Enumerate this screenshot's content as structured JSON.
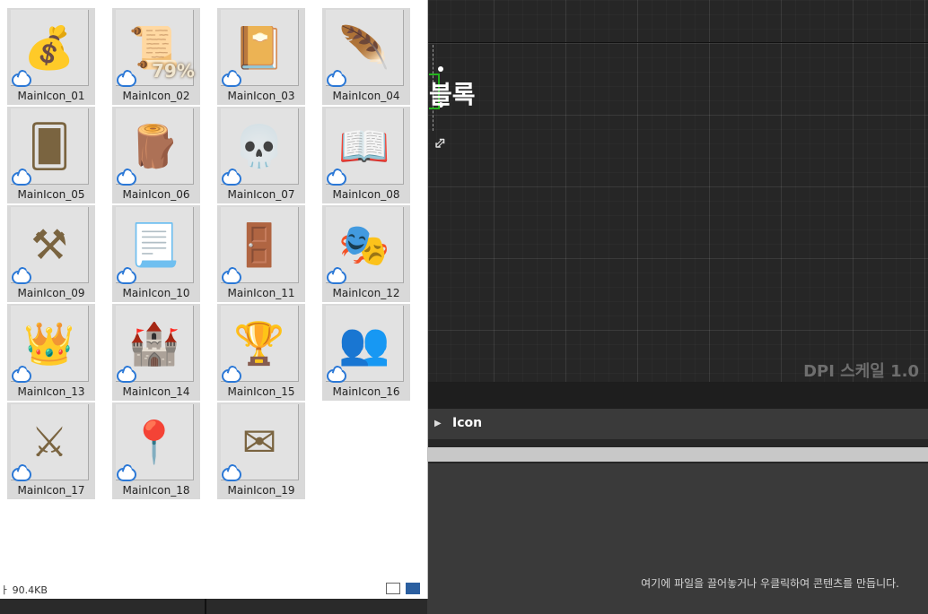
{
  "explorer": {
    "files": [
      {
        "name": "MainIcon_01",
        "icon": "money-bag-icon",
        "glyph": "💰"
      },
      {
        "name": "MainIcon_02",
        "icon": "sale-scroll-icon",
        "glyph": "📜",
        "overlay": "79%"
      },
      {
        "name": "MainIcon_03",
        "icon": "compass-book-icon",
        "glyph": "📔"
      },
      {
        "name": "MainIcon_04",
        "icon": "quill-scroll-icon",
        "glyph": "🪶"
      },
      {
        "name": "MainIcon_05",
        "icon": "cards-icon",
        "glyph": "🂠"
      },
      {
        "name": "MainIcon_06",
        "icon": "tree-stump-icon",
        "glyph": "🪵"
      },
      {
        "name": "MainIcon_07",
        "icon": "bull-skull-icon",
        "glyph": "💀"
      },
      {
        "name": "MainIcon_08",
        "icon": "open-book-icon",
        "glyph": "📖"
      },
      {
        "name": "MainIcon_09",
        "icon": "crossed-hammers-icon",
        "glyph": "⚒"
      },
      {
        "name": "MainIcon_10",
        "icon": "checked-scroll-icon",
        "glyph": "📃"
      },
      {
        "name": "MainIcon_11",
        "icon": "door-icon",
        "glyph": "🚪"
      },
      {
        "name": "MainIcon_12",
        "icon": "mask-icon",
        "glyph": "🎭"
      },
      {
        "name": "MainIcon_13",
        "icon": "crown-shield-icon",
        "glyph": "👑"
      },
      {
        "name": "MainIcon_14",
        "icon": "castle-tower-icon",
        "glyph": "🏰"
      },
      {
        "name": "MainIcon_15",
        "icon": "trophy-icon",
        "glyph": "🏆"
      },
      {
        "name": "MainIcon_16",
        "icon": "group-icon",
        "glyph": "👥"
      },
      {
        "name": "MainIcon_17",
        "icon": "crossed-swords-icon",
        "glyph": "⚔"
      },
      {
        "name": "MainIcon_18",
        "icon": "map-pin-icon",
        "glyph": "📍"
      },
      {
        "name": "MainIcon_19",
        "icon": "sealed-letter-icon",
        "glyph": "✉"
      }
    ],
    "status_text": "ㅏ 90.4KB"
  },
  "canvas": {
    "text_fragment": "블록",
    "dpi_label": "DPI 스케일 1.0"
  },
  "details": {
    "section_label": "Icon"
  },
  "content_browser": {
    "empty_message": "여기에 파일을 끌어놓거나 우클릭하여 콘텐츠를 만듭니다."
  },
  "colors": {
    "cloud_sync": "#2b78d6",
    "selection_green": "#25b31f"
  }
}
